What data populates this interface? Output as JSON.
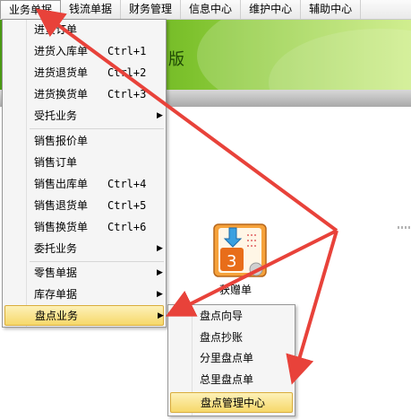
{
  "menubar": [
    "业务单据",
    "钱流单据",
    "财务管理",
    "信息中心",
    "维护中心",
    "辅助中心"
  ],
  "banner_title": "版",
  "app_icon": {
    "label": "获赠单"
  },
  "menu": {
    "group1": [
      {
        "label": "进货订单",
        "shortcut": ""
      },
      {
        "label": "进货入库单",
        "shortcut": "Ctrl+1"
      },
      {
        "label": "进货退货单",
        "shortcut": "Ctrl+2"
      },
      {
        "label": "进货换货单",
        "shortcut": "Ctrl+3"
      },
      {
        "label": "受托业务",
        "submenu": true
      }
    ],
    "group2": [
      {
        "label": "销售报价单",
        "shortcut": ""
      },
      {
        "label": "销售订单",
        "shortcut": ""
      },
      {
        "label": "销售出库单",
        "shortcut": "Ctrl+4"
      },
      {
        "label": "销售退货单",
        "shortcut": "Ctrl+5"
      },
      {
        "label": "销售换货单",
        "shortcut": "Ctrl+6"
      },
      {
        "label": "委托业务",
        "submenu": true
      }
    ],
    "group3": [
      {
        "label": "零售单据",
        "submenu": true
      },
      {
        "label": "库存单据",
        "submenu": true
      },
      {
        "label": "盘点业务",
        "submenu": true,
        "highlighted": true
      }
    ]
  },
  "submenu": [
    {
      "label": "盘点向导"
    },
    {
      "label": "盘点抄账"
    },
    {
      "label": "分里盘点单"
    },
    {
      "label": "总里盘点单"
    },
    {
      "label": "盘点管理中心",
      "highlighted": true
    }
  ],
  "colors": {
    "arrow": "#e8423a",
    "highlight": "#f6d86a",
    "banner": "#7cc12c"
  }
}
